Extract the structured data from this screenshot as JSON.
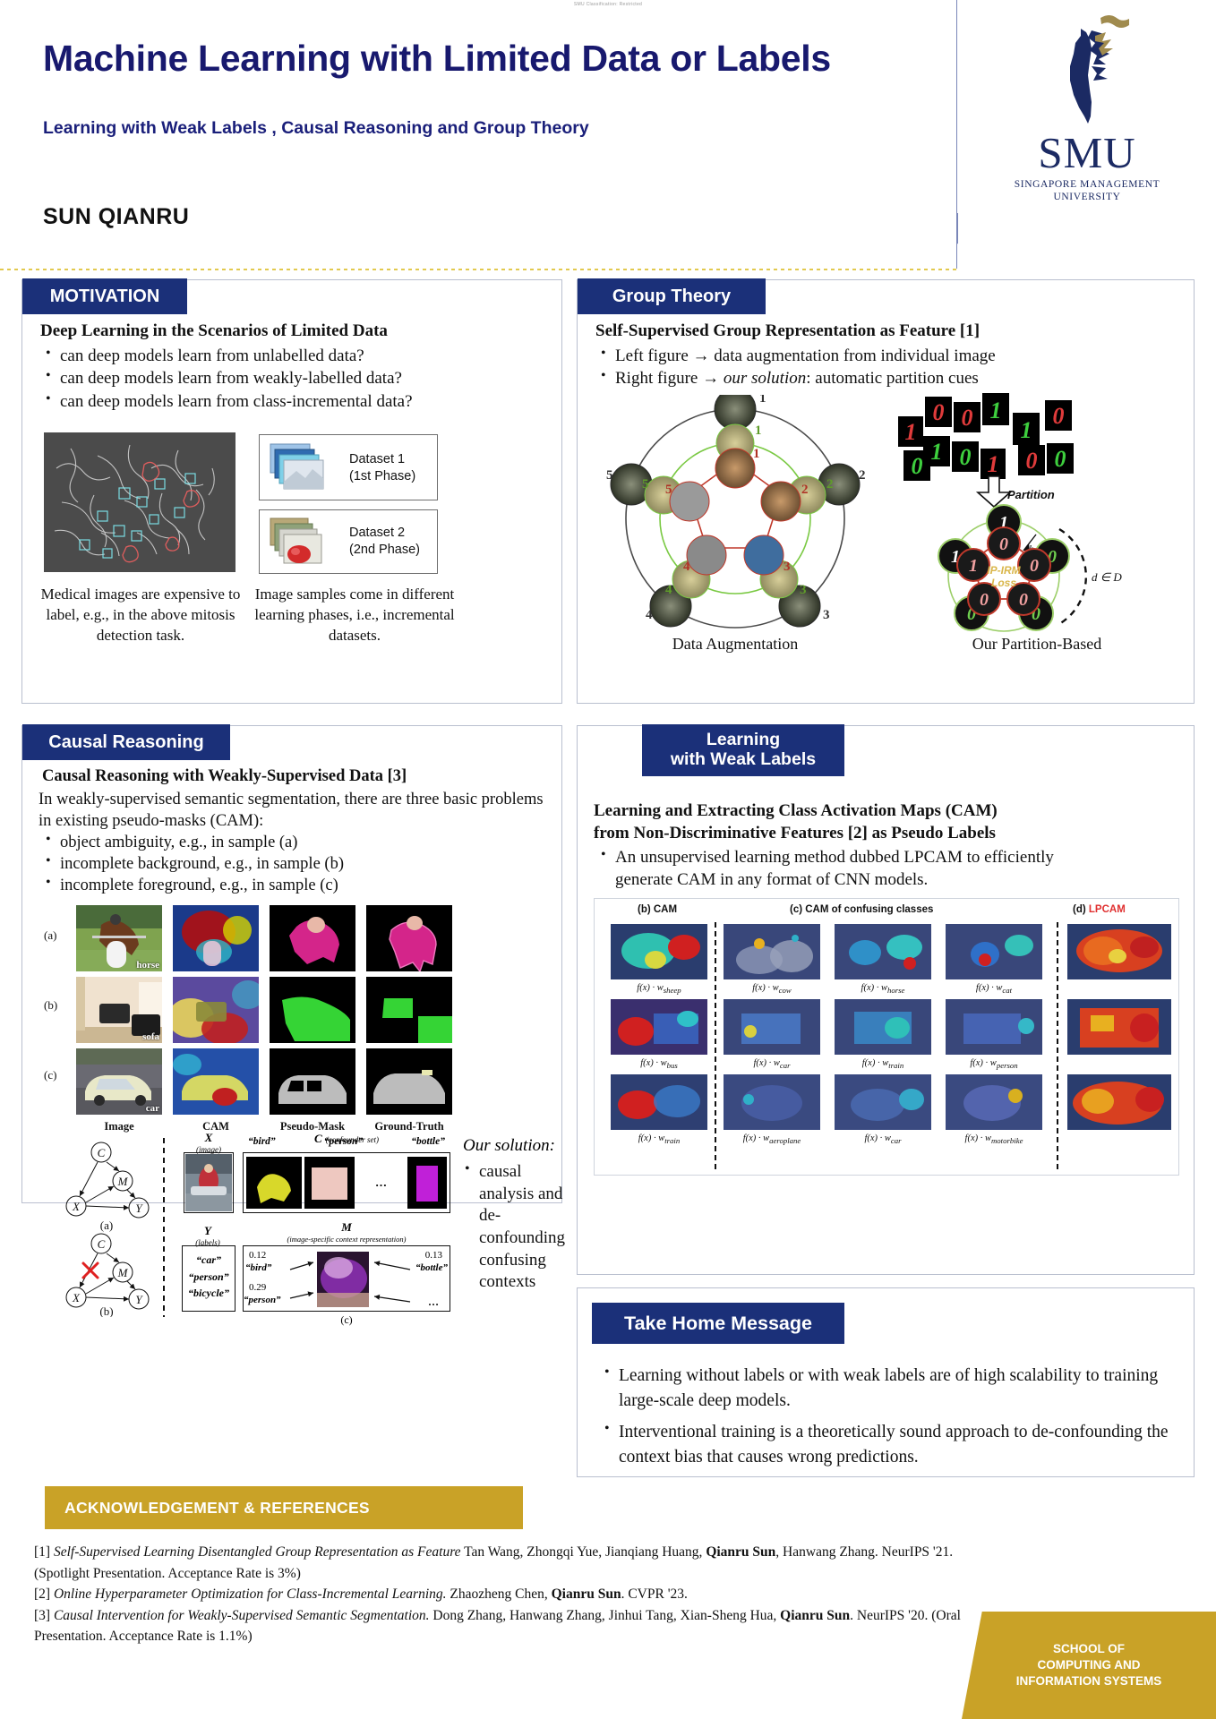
{
  "classification_note": "SMU Classification: Restricted",
  "header": {
    "title": "Machine Learning with Limited Data or Labels",
    "subtitle": "Learning with Weak Labels , Causal Reasoning and Group Theory",
    "author": "SUN QIANRU",
    "logo": {
      "wordmark": "SMU",
      "tagline_line1": "SINGAPORE MANAGEMENT",
      "tagline_line2": "UNIVERSITY",
      "icon": "smu-lion-logo"
    }
  },
  "colors": {
    "section_header_blue": "#1b3079",
    "title_blue": "#18196e",
    "accent_gold": "#c9a227",
    "lpcam_red": "#e03030"
  },
  "motivation": {
    "section_title": "MOTIVATION",
    "heading": "Deep Learning in the Scenarios of Limited Data",
    "bullets": [
      "can deep models learn from unlabelled data?",
      "can deep models learn from weakly-labelled data?",
      "can deep models learn from class-incremental data?"
    ],
    "dataset_boxes": [
      {
        "line1": "Dataset 1",
        "line2": "(1st Phase)"
      },
      {
        "line1": "Dataset 2",
        "line2": "(2nd Phase)"
      }
    ],
    "caption_left": "Medical images are expensive to label, e.g., in the above mitosis detection task.",
    "caption_right": "Image samples come in different learning phases, i.e., incremental datasets."
  },
  "group_theory": {
    "section_title": "Group Theory",
    "heading": "Self-Supervised Group Representation as Feature [1]",
    "bullets": [
      "Left figure → data augmentation from individual image",
      "Right figure → our solution: automatic partition cues"
    ],
    "bullet2_italic": "our solution",
    "left_figure": {
      "caption": "Data Augmentation",
      "ring_labels_outer": [
        "1",
        "2",
        "3",
        "4",
        "5"
      ],
      "ring_labels_mid": [
        "1",
        "2",
        "3",
        "4",
        "5"
      ],
      "ring_labels_inner": [
        "1",
        "2",
        "3",
        "4",
        "5"
      ]
    },
    "right_figure": {
      "caption": "Our Partition-Based",
      "partition_label": "Partition",
      "loss_label_line1": "IP-IRM",
      "loss_label_line2": "Loss",
      "h_label": "h",
      "d_label": "d ∈ D",
      "digits": [
        "1",
        "0",
        "0",
        "1",
        "0",
        "1",
        "0",
        "0",
        "1",
        "0",
        "0",
        "0"
      ]
    }
  },
  "causal_reasoning": {
    "section_title": "Causal Reasoning",
    "heading": "Causal Reasoning with Weakly-Supervised Data [3]",
    "paragraph": "In weakly-supervised semantic segmentation, there are three basic problems in existing pseudo-masks (CAM):",
    "bullets": [
      "object ambiguity, e.g., in sample (a)",
      "incomplete background, e.g., in sample (b)",
      "incomplete foreground, e.g., in sample (c)"
    ],
    "grid": {
      "column_headers": [
        "Image",
        "CAM",
        "Pseudo-Mask",
        "Ground-Truth"
      ],
      "row_labels": [
        "(a)",
        "(b)",
        "(c)"
      ],
      "row_tags": [
        "horse",
        "sofa",
        "car"
      ]
    },
    "dag": {
      "nodes": [
        "C",
        "M",
        "X",
        "Y"
      ],
      "sub_labels": [
        "(a)",
        "(b)",
        "(c)"
      ],
      "x_label": "X",
      "x_sub": "(image)",
      "c_label": "C",
      "c_sub": "(confounder set)",
      "confounders": [
        "“bird”",
        "“person”",
        "“bottle”"
      ],
      "ellipsis": "…",
      "y_label": "Y",
      "y_sub": "(labels)",
      "y_items": [
        "“car”",
        "“person”",
        "“bicycle”"
      ],
      "m_label": "M",
      "m_sub": "(image-specific context representation)",
      "m_values": [
        {
          "value": "0.12",
          "name": "“bird”"
        },
        {
          "value": "0.13",
          "name": "“bottle”"
        },
        {
          "value": "0.29",
          "name": "“person”"
        }
      ]
    },
    "solution": {
      "title": "Our solution:",
      "bullet": "causal analysis and de-confounding confusing contexts"
    }
  },
  "weak_labels": {
    "section_title_line1": "Learning",
    "section_title_line2": "with Weak Labels",
    "heading_line1": "Learning and Extracting Class Activation Maps (CAM)",
    "heading_line2": "from Non-Discriminative Features [2] as Pseudo Labels",
    "bullet": "An unsupervised learning method dubbed LPCAM to efficiently generate CAM in any format of CNN models.",
    "figure": {
      "col_b": "(b)  CAM",
      "col_c": "(c)  CAM of confusing classes",
      "col_d_prefix": "(d)  ",
      "col_d": "LPCAM",
      "rows": [
        [
          "f(x) · w",
          "sheep",
          "cow",
          "horse",
          "cat"
        ],
        [
          "f(x) · w",
          "bus",
          "car",
          "train",
          "person"
        ],
        [
          "f(x) · w",
          "train",
          "aeroplane",
          "car",
          "motorbike"
        ]
      ]
    }
  },
  "take_home": {
    "section_title": "Take Home Message",
    "bullets": [
      "Learning without labels or with weak labels are of high scalability to training large-scale deep models.",
      "Interventional training is a theoretically sound approach to de-confounding the context bias that causes wrong predictions."
    ]
  },
  "acknowledgement": {
    "section_title": "ACKNOWLEDGEMENT & REFERENCES",
    "references": [
      {
        "num": "[1]",
        "italic": "Self-Supervised Learning Disentangled Group Representation as Feature",
        "rest_pre": " Tan Wang, Zhongqi Yue, Jianqiang Huang, ",
        "bold": "Qianru Sun",
        "rest_post": ", Hanwang Zhang. NeurIPS '21. (Spotlight Presentation. Acceptance Rate is 3%)"
      },
      {
        "num": "[2]",
        "italic": "Online Hyperparameter Optimization for Class-Incremental Learning.",
        "rest_pre": " Zhaozheng Chen, ",
        "bold": "Qianru Sun",
        "rest_post": ". CVPR '23."
      },
      {
        "num": "[3]",
        "italic": "Causal Intervention for Weakly-Supervised Semantic Segmentation.",
        "rest_pre": " Dong Zhang, Hanwang Zhang, Jinhui Tang, Xian-Sheng Hua, ",
        "bold": "Qianru Sun",
        "rest_post": ". NeurIPS '20. (Oral Presentation. Acceptance Rate is 1.1%)"
      }
    ],
    "school_badge": {
      "line1": "SCHOOL OF",
      "line2": "COMPUTING AND",
      "line3": "INFORMATION SYSTEMS"
    }
  }
}
